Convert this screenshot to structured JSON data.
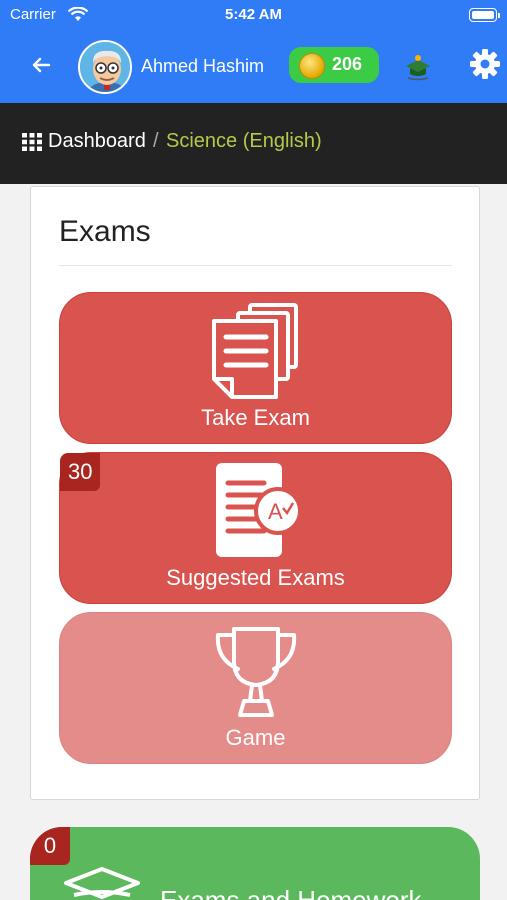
{
  "status_bar": {
    "carrier": "Carrier",
    "time": "5:42 AM"
  },
  "header": {
    "user_name": "Ahmed Hashim",
    "coins": "206",
    "icons": {
      "back": "arrow-left-icon",
      "avatar": "user-avatar",
      "coin": "coin-icon",
      "logo": "app-logo",
      "settings": "gear-icon"
    },
    "colors": {
      "bar": "#2f7cf6",
      "coin_badge": "#3ccb45"
    }
  },
  "breadcrumb": {
    "home": "Dashboard",
    "separator": "/",
    "current": "Science (English)",
    "colors": {
      "background": "#222222",
      "current": "#b5c94a"
    }
  },
  "exams": {
    "title": "Exams",
    "tiles": [
      {
        "label": "Take Exam",
        "icon": "documents-icon",
        "color": "#d9534f"
      },
      {
        "label": "Suggested Exams",
        "icon": "graded-exam-icon",
        "badge": "30",
        "color": "#d9534f"
      },
      {
        "label": "Game",
        "icon": "trophy-icon",
        "color": "#e48c89"
      }
    ]
  },
  "homework": {
    "badge": "0",
    "label": "Exams and Homework",
    "icon": "graduation-cap-icon",
    "color": "#5cb85c"
  }
}
